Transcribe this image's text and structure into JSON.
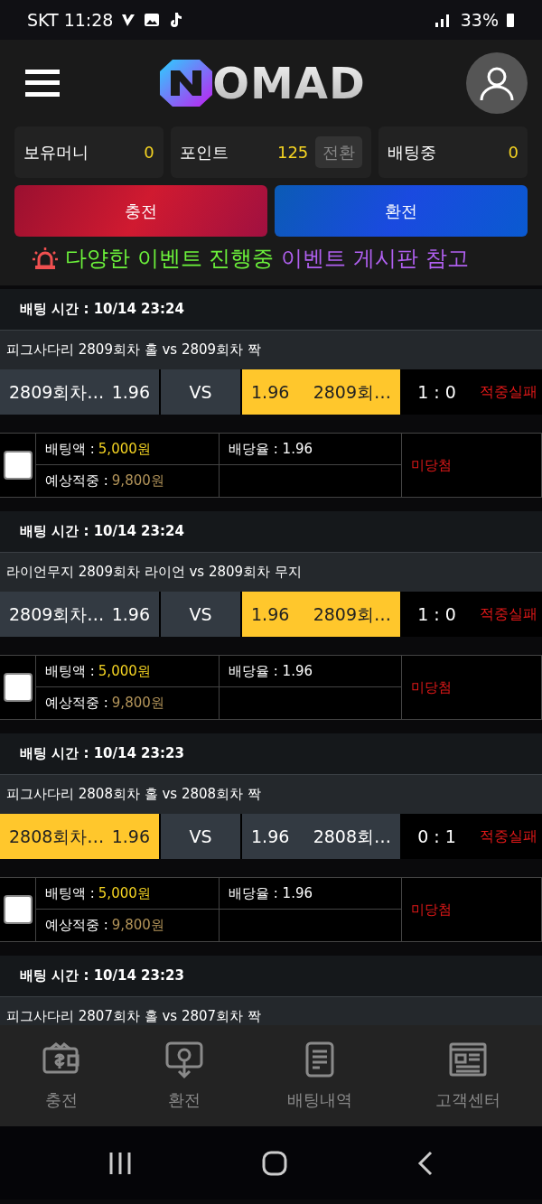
{
  "status_bar": {
    "carrier_time": "SKT 11:28",
    "battery": "33%"
  },
  "header": {
    "logo": "OMAD"
  },
  "stats": [
    {
      "label": "보유머니",
      "value": "0"
    },
    {
      "label": "포인트",
      "value": "125",
      "action": "전환"
    },
    {
      "label": "배팅중",
      "value": "0"
    }
  ],
  "actions": [
    {
      "label": "충전",
      "kind": "charge"
    },
    {
      "label": "환전",
      "kind": "exchange"
    }
  ],
  "notice": {
    "text1": "다양한 이벤트 진행중",
    "text2": "이벤트 게시판 참고"
  },
  "bets": [
    {
      "time": "배팅 시간 : 10/14 23:24",
      "title": "피그사다리 2809회차 홀  vs  2809회차 짝",
      "home": {
        "label": "2809회차…",
        "odds": "1.96",
        "selected": false
      },
      "vs": "VS",
      "away": {
        "label": "2809회…",
        "odds": "1.96",
        "selected": true
      },
      "score": "1 : 0",
      "result": "적중실패",
      "checked": false,
      "amount_label": "배팅액 :",
      "amount": "5,000원",
      "rate": "배당율 : 1.96",
      "expected_label": "예상적중 :",
      "expected": "9,800원",
      "status": "미당첨"
    },
    {
      "time": "배팅 시간 : 10/14 23:24",
      "title": "라이언무지 2809회차 라이언  vs  2809회차 무지",
      "home": {
        "label": "2809회차…",
        "odds": "1.96",
        "selected": false
      },
      "vs": "VS",
      "away": {
        "label": "2809회…",
        "odds": "1.96",
        "selected": true
      },
      "score": "1 : 0",
      "result": "적중실패",
      "checked": false,
      "amount_label": "배팅액 :",
      "amount": "5,000원",
      "rate": "배당율 : 1.96",
      "expected_label": "예상적중 :",
      "expected": "9,800원",
      "status": "미당첨"
    },
    {
      "time": "배팅 시간 : 10/14 23:23",
      "title": "피그사다리 2808회차 홀  vs  2808회차 짝",
      "home": {
        "label": "2808회차…",
        "odds": "1.96",
        "selected": true
      },
      "vs": "VS",
      "away": {
        "label": "2808회…",
        "odds": "1.96",
        "selected": false
      },
      "score": "0 : 1",
      "result": "적중실패",
      "checked": false,
      "amount_label": "배팅액 :",
      "amount": "5,000원",
      "rate": "배당율 : 1.96",
      "expected_label": "예상적중 :",
      "expected": "9,800원",
      "status": "미당첨"
    },
    {
      "time": "배팅 시간 : 10/14 23:23",
      "title": "피그사다리 2807회차 홀  vs  2807회차 짝"
    }
  ],
  "bottom_nav": [
    {
      "label": "충전",
      "kind": "wallet"
    },
    {
      "label": "환전",
      "kind": "withdraw"
    },
    {
      "label": "배팅내역",
      "kind": "document"
    },
    {
      "label": "고객센터",
      "kind": "news"
    }
  ]
}
